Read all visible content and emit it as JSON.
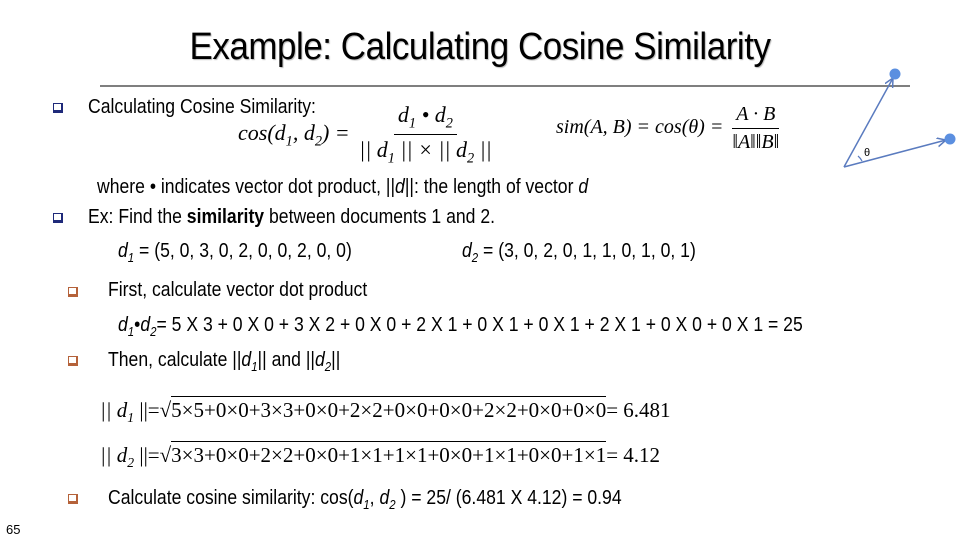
{
  "slide": {
    "title": "Example: Calculating Cosine Similarity",
    "page_number": "65",
    "colors": {
      "bullet_level1": "#1f2a7a",
      "bullet_level2": "#b5623a",
      "rule": "#7f7f7f",
      "vector_line": "#5a7bbf",
      "vector_point": "#5b8fe0"
    }
  },
  "bullets": {
    "b1": {
      "label": "Calculating Cosine Similarity:",
      "icon": "square-bullet-icon"
    },
    "formula1": {
      "lhs": "cos(d",
      "lhs_sub1": "1",
      "lhs_mid": ", d",
      "lhs_sub2": "2",
      "lhs_end": ") =",
      "numerator_a": "d",
      "numerator_sub1": "1",
      "numerator_op": " • d",
      "numerator_sub2": "2",
      "denominator_a": "|| d",
      "denominator_sub1": "1",
      "denominator_op": " || × || d",
      "denominator_sub2": "2",
      "denominator_end": " ||"
    },
    "formula2": {
      "lhs": "sim(A, B) = cos(θ) =",
      "numerator": "A · B",
      "denominator": "‖A‖‖B‖"
    },
    "diagram": {
      "angle_label": "θ"
    },
    "where_line": {
      "prefix": "where • indicates vector dot product, ||",
      "var": "d",
      "mid": "||: the length of vector ",
      "var2": "d"
    },
    "b2": {
      "prefix": "Ex: Find the ",
      "bold": "similarity",
      "suffix": " between documents 1 and 2."
    },
    "vectors": {
      "d1_name": "d",
      "d1_sub": "1",
      "d1_value": " =  (5, 0, 3, 0, 2, 0, 0, 2, 0, 0)",
      "d2_name": "d",
      "d2_sub": "2",
      "d2_value": " =  (3, 0, 2, 0, 1, 1, 0, 1, 0, 1)"
    },
    "b3": {
      "label": "First, calculate vector dot product"
    },
    "dot_product": {
      "a": "d",
      "a_sub": "1",
      "op": "•",
      "b": "d",
      "b_sub": "2",
      "expression": "= 5 X 3 + 0 X 0 + 3 X 2 + 0 X 0 + 2 X 1 + 0 X 1 + 0 X 1 + 2 X 1 + 0 X 0 + 0 X 1 = 25"
    },
    "b4": {
      "prefix": "Then, calculate ||",
      "var1": "d",
      "sub1": "1",
      "mid": "|| and ||",
      "var2": "d",
      "sub2": "2",
      "suffix": "||"
    },
    "norm1": {
      "lhs": "|| d",
      "lhs_sub": "1",
      "lhs_end": " ||=",
      "radicand": "5×5+0×0+3×3+0×0+2×2+0×0+0×0+2×2+0×0+0×0",
      "result": "= 6.481"
    },
    "norm2": {
      "lhs": "|| d",
      "lhs_sub": "2",
      "lhs_end": " ||=",
      "radicand": "3×3+0×0+2×2+0×0+1×1+1×1+0×0+1×1+0×0+1×1",
      "result": "= 4.12"
    },
    "b5": {
      "prefix": "Calculate cosine similarity:  cos(",
      "var1": "d",
      "sub1": "1",
      "mid": ", ",
      "var2": "d",
      "sub2": "2",
      "suffix": " ) = 25/ (6.481 X 4.12) = 0.94"
    }
  }
}
